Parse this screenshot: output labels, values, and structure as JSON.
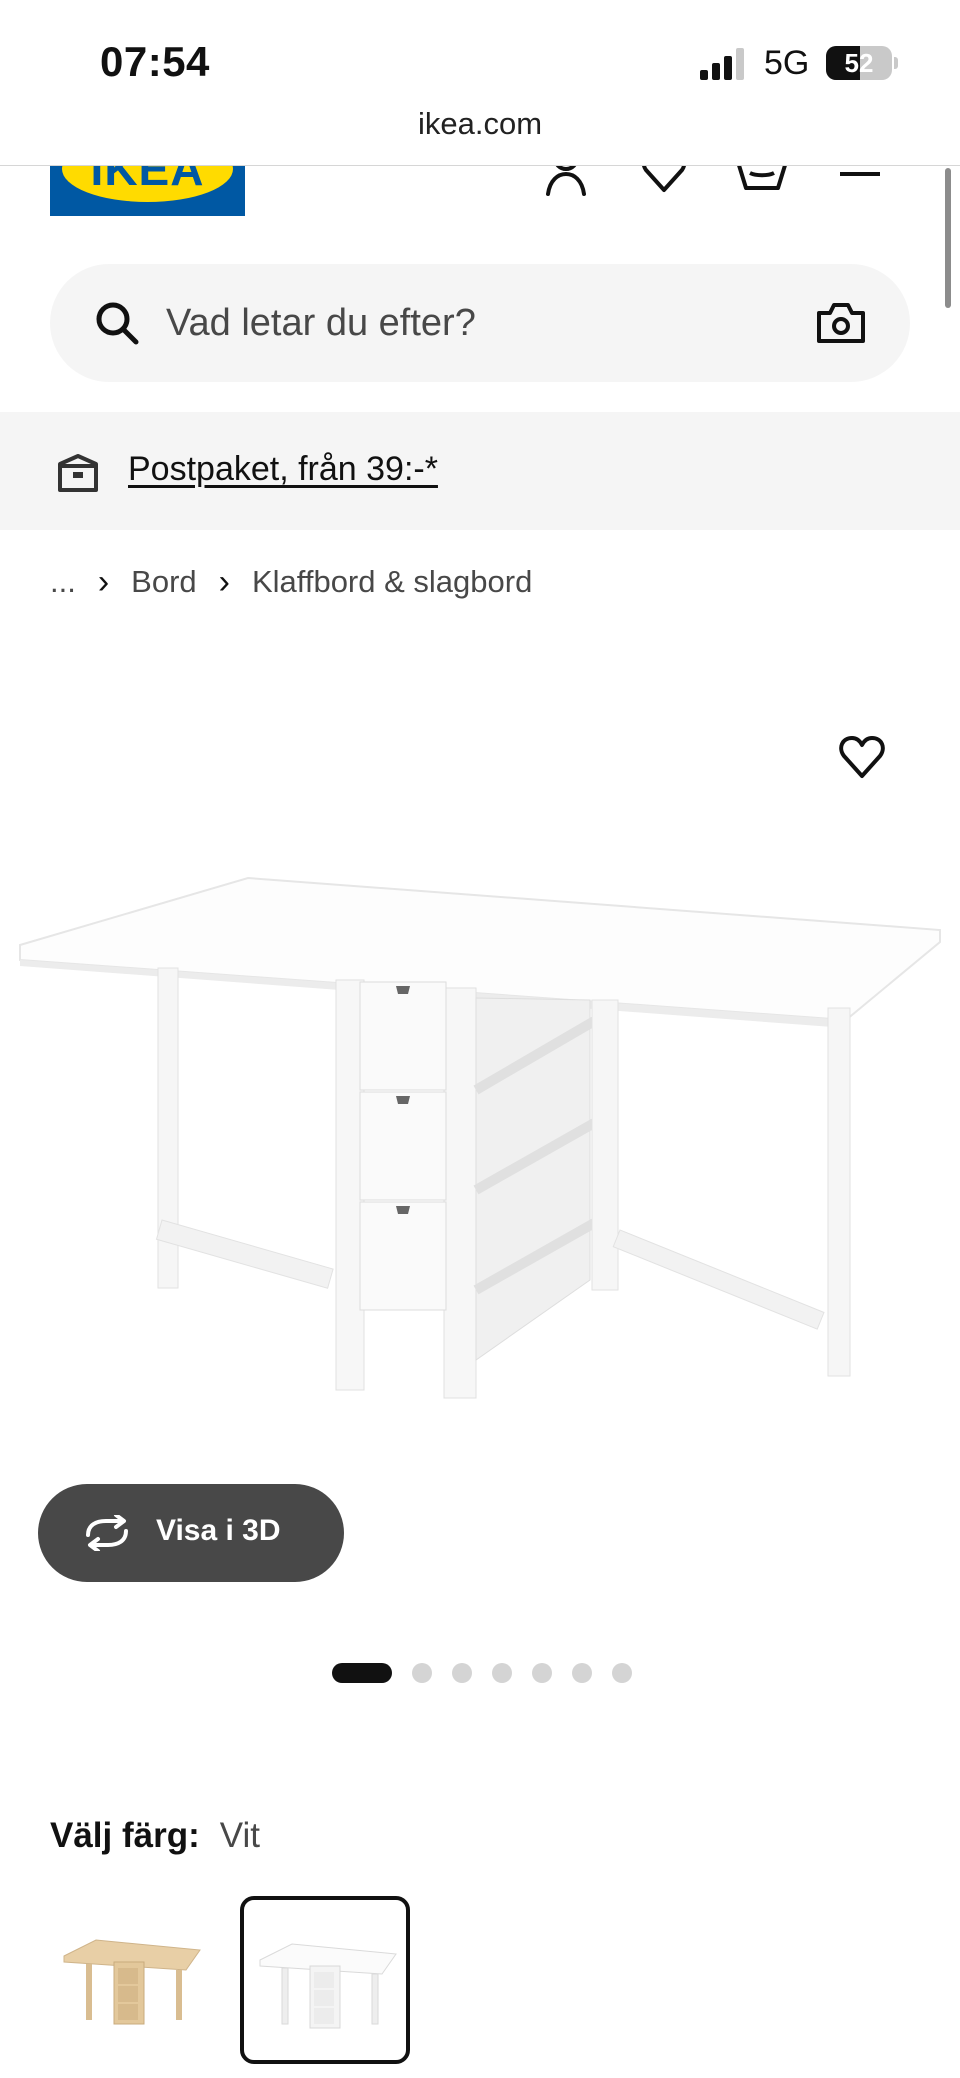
{
  "status_bar": {
    "time": "07:54",
    "network": "5G",
    "battery": "52",
    "battery_level": 0.52
  },
  "browser": {
    "url": "ikea.com"
  },
  "header": {
    "logo_text": "IKEA",
    "icons": [
      "user-icon",
      "heart-icon",
      "basket-icon",
      "menu-icon"
    ]
  },
  "search": {
    "placeholder": "Vad letar du efter?"
  },
  "banner": {
    "text": "Postpaket, från 39:-*"
  },
  "breadcrumb": {
    "ellipsis": "...",
    "items": [
      "Bord",
      "Klaffbord & slagbord"
    ]
  },
  "product": {
    "view_3d_label": "Visa i 3D",
    "image_count": 7,
    "active_image": 1
  },
  "color_picker": {
    "label": "Välj färg:",
    "value": "Vit",
    "options": [
      "birch",
      "white"
    ],
    "selected": "white"
  },
  "colors": {
    "brand_blue": "#0058a3",
    "brand_yellow": "#ffdb00",
    "button_gray": "#484848",
    "surface": "#f5f5f5"
  }
}
